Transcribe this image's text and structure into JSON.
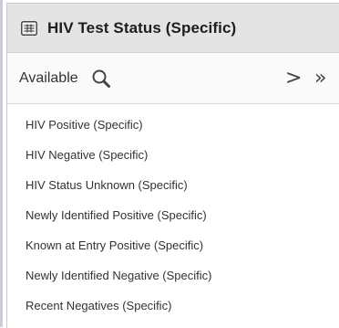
{
  "panel": {
    "title": "HIV Test Status (Specific)",
    "icon": "grid-icon"
  },
  "toolbar": {
    "label": "Available",
    "search_icon": "search-icon",
    "move_selected": ">",
    "move_all": "»"
  },
  "items": [
    {
      "label": "HIV Positive (Specific)"
    },
    {
      "label": "HIV Negative (Specific)"
    },
    {
      "label": "HIV Status Unknown (Specific)"
    },
    {
      "label": "Newly Identified Positive (Specific)"
    },
    {
      "label": "Known at Entry Positive (Specific)"
    },
    {
      "label": "Newly Identified Negative (Specific)"
    },
    {
      "label": "Recent Negatives (Specific)"
    }
  ]
}
